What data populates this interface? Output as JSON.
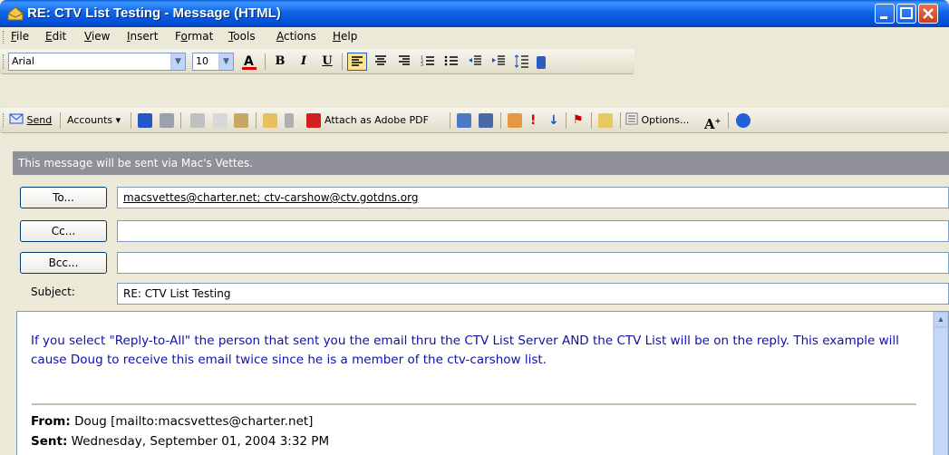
{
  "window": {
    "title": "RE: CTV List Testing - Message (HTML)"
  },
  "menu": [
    {
      "label": "File",
      "key": "F"
    },
    {
      "label": "Edit",
      "key": "E"
    },
    {
      "label": "View",
      "key": "V"
    },
    {
      "label": "Insert",
      "key": "I"
    },
    {
      "label": "Format",
      "key": "o"
    },
    {
      "label": "Tools",
      "key": "T"
    },
    {
      "label": "Actions",
      "key": "A"
    },
    {
      "label": "Help",
      "key": "H"
    }
  ],
  "format_toolbar": {
    "font": "Arial",
    "size": "10"
  },
  "standard_toolbar": {
    "send": "Send",
    "accounts": "Accounts",
    "attach_pdf": "Attach as Adobe PDF",
    "options": "Options..."
  },
  "info_bar": "This message will be sent via Mac's Vettes.",
  "header": {
    "to_button": "To...",
    "cc_button": "Cc...",
    "bcc_button": "Bcc...",
    "to_value": "macsvettes@charter.net; ctv-carshow@ctv.gotdns.org",
    "cc_value": "",
    "bcc_value": "",
    "subject_label": "Subject:",
    "subject_value": "RE: CTV List Testing"
  },
  "body": {
    "text": "If you select \"Reply-to-All\" the person that sent you the email thru the CTV List Server AND the CTV List will be on the reply.  This example will cause Doug to receive this email twice since he is a member of the ctv-carshow list.",
    "from_label": "From:",
    "from_value": "Doug [mailto:macsvettes@charter.net]",
    "sent_label": "Sent:",
    "sent_value": "Wednesday, September 01, 2004 3:32 PM"
  },
  "colors": {
    "title_blue": "#0050d8",
    "info_bar": "#8f9098",
    "body_text": "#1010a8"
  }
}
